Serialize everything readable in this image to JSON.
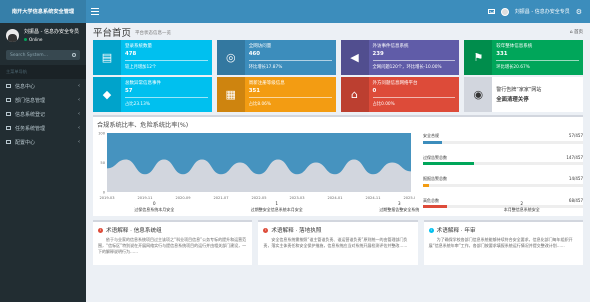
{
  "app": {
    "logo": "南开大学信息系统安全管理",
    "top_user": "刘振昌 - 信息办安全专员"
  },
  "sidebar": {
    "user_name": "刘振昌 - 信息办安全专员",
    "status": "Online",
    "search_placeholder": "Search System...",
    "menu_header": "主菜单导航",
    "items": [
      {
        "label": "信息中心"
      },
      {
        "label": "部门信息管理"
      },
      {
        "label": "信息系统登记"
      },
      {
        "label": "任务系统管理"
      },
      {
        "label": "配置中心"
      }
    ]
  },
  "page": {
    "title": "平台首页",
    "subtitle": "平台状态信息一览",
    "breadcrumb": "首页"
  },
  "tiles": [
    {
      "label": "登录系统数量",
      "value": "478",
      "foot": "较上月增加12个",
      "color": "#00c0ef",
      "icon": "clipboard-icon",
      "glyph": "▤"
    },
    {
      "label": "全网访问量",
      "value": "460",
      "foot": "环比增长17.87%",
      "color": "#3c8dbc",
      "icon": "globe-icon",
      "glyph": "◎"
    },
    {
      "label": "外访事件信息系统",
      "value": "239",
      "foot": "全网问题120个，环比增长-10.00%",
      "color": "#605ca8",
      "icon": "megaphone-icon",
      "glyph": "◀"
    },
    {
      "label": "较年整体信息系统",
      "value": "331",
      "foot": "环比增长20.67%",
      "color": "#00a65a",
      "icon": "flag-icon",
      "glyph": "⚑"
    },
    {
      "label": "总数异常信息事件",
      "value": "57",
      "foot": "占比23.13%",
      "color": "#00c0ef",
      "icon": "cube-icon",
      "glyph": "◆"
    },
    {
      "label": "周新注册等级信息",
      "value": "351",
      "foot": "占比8.06%",
      "color": "#f39c12",
      "icon": "stack-icon",
      "glyph": "▦"
    },
    {
      "label": "外方问题信息网络平台",
      "value": "0",
      "foot": "占比0.00%",
      "color": "#dd4b39",
      "icon": "home-icon",
      "glyph": "⌂"
    },
    {
      "label": "警行告牌“家家”网站",
      "value": "全面清理关停",
      "foot": "",
      "color": "#d2d6de",
      "icon": "eye-slash-icon",
      "glyph": "◉",
      "plain": true
    }
  ],
  "chart_data": {
    "type": "area",
    "title": "合规系统比率、危险系统比率(%)",
    "x": [
      "2019-03",
      "2019-06",
      "2019-11",
      "2020-04",
      "2020-09",
      "2021-02",
      "2021-07",
      "2021-12",
      "2022-05",
      "2022-10",
      "2023-03",
      "2023-08",
      "2024-01",
      "2024-06",
      "2024-11",
      "2025-04",
      "2025-09"
    ],
    "series": [
      {
        "name": "合规系统比率",
        "color": "#3c8dbc",
        "values": [
          100,
          100,
          100,
          100,
          100,
          100,
          100,
          100,
          100,
          100,
          100,
          100,
          100,
          100,
          100,
          100,
          100
        ]
      },
      {
        "name": "危险系统比率",
        "color": "#d2d6de",
        "values": [
          40,
          55,
          30,
          55,
          30,
          55,
          30,
          50,
          30,
          55,
          30,
          50,
          30,
          55,
          30,
          50,
          35
        ]
      }
    ],
    "legend_position": "right",
    "stats": [
      {
        "label": "安全合规",
        "value": "57/457",
        "pct": 12,
        "color": "#3c8dbc"
      },
      {
        "label": "过保告警总数",
        "value": "147/457",
        "pct": 32,
        "color": "#00a65a"
      },
      {
        "label": "报报告警总数",
        "value": "14/457",
        "pct": 4,
        "color": "#f39c12"
      },
      {
        "label": "高危总数",
        "value": "68/457",
        "pct": 15,
        "color": "#dd4b39"
      }
    ],
    "footer": [
      {
        "n": "0",
        "label": "过保信息系统本月安全"
      },
      {
        "n": "1",
        "label": "过期整安全信息系统本月安全"
      },
      {
        "n": "3",
        "label": "过期整报告整安全系统"
      },
      {
        "n": "2",
        "label": "本月整信息系统安全"
      }
    ]
  },
  "panels": [
    {
      "title": "术语解释 · 信息系统组",
      "color": "#dd4b39",
      "icon": "info-icon",
      "text": "依于与业家的信息系统项目过主该项之“科业项目信息”公务专标的提升和运营范围，“信标区”特别说在开展网络实行与提信息系统项目的运行并由相关部门建设，一下的解释说明行为……"
    },
    {
      "title": "术语解释 · 落地执照",
      "color": "#dd4b39",
      "icon": "info-icon",
      "text": "安全信息系统需按照“谁主管谁负责、谁运营谁负责”原则统一的由管理部门负责，落实主体责任和安全保护措施，信息系统应当对系统开展检测评估并整改……"
    },
    {
      "title": "术语解释 · 年审",
      "color": "#00c0ef",
      "icon": "info-icon",
      "text": "为了确保学校各部门信息系统能够持续符合安全要求，信息化部门每年组织开展“信息系统年审”工作，各部门按要求填报系统运行情况并提交整改计划……"
    }
  ]
}
